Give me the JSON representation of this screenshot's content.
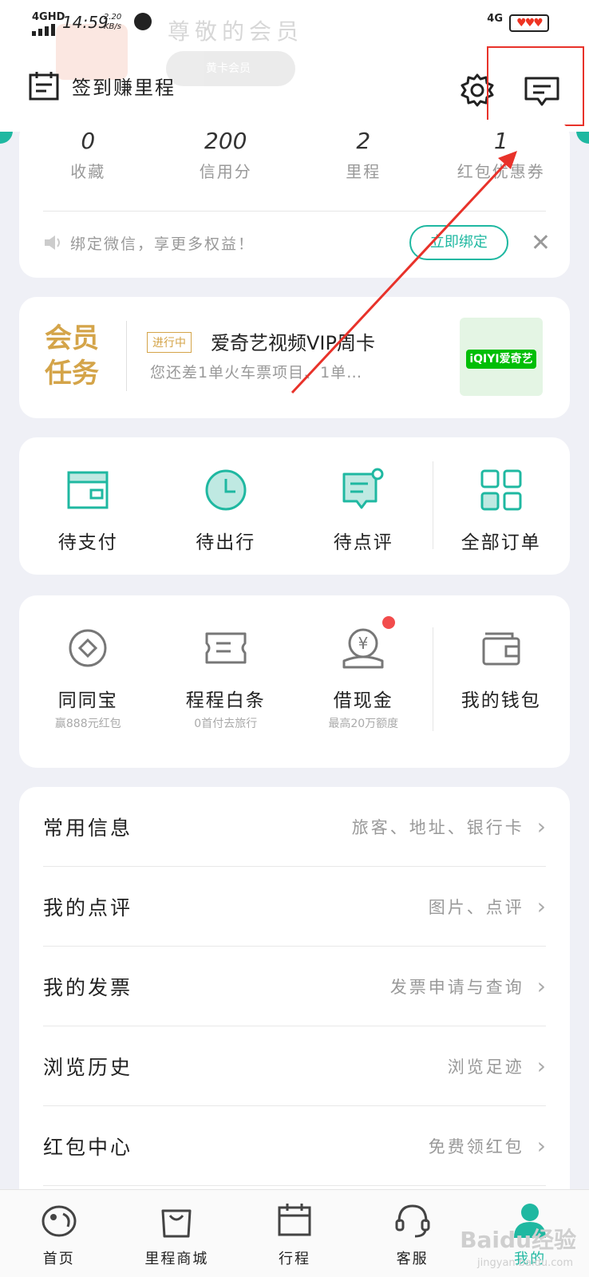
{
  "status_bar": {
    "network": "4GHD",
    "time": "14:59",
    "speed": "2.20 KB/s",
    "network_right": "4G",
    "battery": "♥♥♥"
  },
  "header": {
    "faded_title": "尊敬的会员",
    "faded_badge": "黄卡会员",
    "signin_label": "签到赚里程"
  },
  "stats": [
    {
      "value": "0",
      "label": "收藏"
    },
    {
      "value": "200",
      "label": "信用分"
    },
    {
      "value": "2",
      "label": "里程"
    },
    {
      "value": "1",
      "label": "红包优惠券"
    }
  ],
  "wechat": {
    "text": "绑定微信，享更多权益！",
    "button": "立即绑定",
    "close": "✕"
  },
  "member_task": {
    "logo": "会员任务",
    "status": "进行中",
    "title": "爱奇艺视频VIP周卡",
    "desc": "您还差1单火车票项目、1单…",
    "brand": "iQIYI爱奇艺"
  },
  "orders": [
    {
      "label": "待支付",
      "icon": "wallet-card-icon"
    },
    {
      "label": "待出行",
      "icon": "clock-icon"
    },
    {
      "label": "待点评",
      "icon": "comment-icon"
    },
    {
      "label": "全部订单",
      "icon": "grid-icon"
    }
  ],
  "finance": [
    {
      "label": "同同宝",
      "sub": "赢888元红包",
      "icon": "diamond-coin-icon"
    },
    {
      "label": "程程白条",
      "sub": "0首付去旅行",
      "icon": "ticket-icon"
    },
    {
      "label": "借现金",
      "sub": "最高20万额度",
      "icon": "yen-coin-icon"
    },
    {
      "label": "我的钱包",
      "sub": "",
      "icon": "wallet-icon"
    }
  ],
  "list": [
    {
      "title": "常用信息",
      "hint": "旅客、地址、银行卡"
    },
    {
      "title": "我的点评",
      "hint": "图片、点评"
    },
    {
      "title": "我的发票",
      "hint": "发票申请与查询"
    },
    {
      "title": "浏览历史",
      "hint": "浏览足迹"
    },
    {
      "title": "红包中心",
      "hint": "免费领红包"
    }
  ],
  "nav": [
    {
      "label": "首页"
    },
    {
      "label": "里程商城"
    },
    {
      "label": "行程"
    },
    {
      "label": "客服"
    },
    {
      "label": "我的"
    }
  ],
  "watermark": {
    "text": "Baidu经验",
    "url": "jingyan.baidu.com"
  },
  "colors": {
    "accent": "#1fb8a1",
    "gold": "#d4a449",
    "annotation_red": "#e8322a"
  }
}
